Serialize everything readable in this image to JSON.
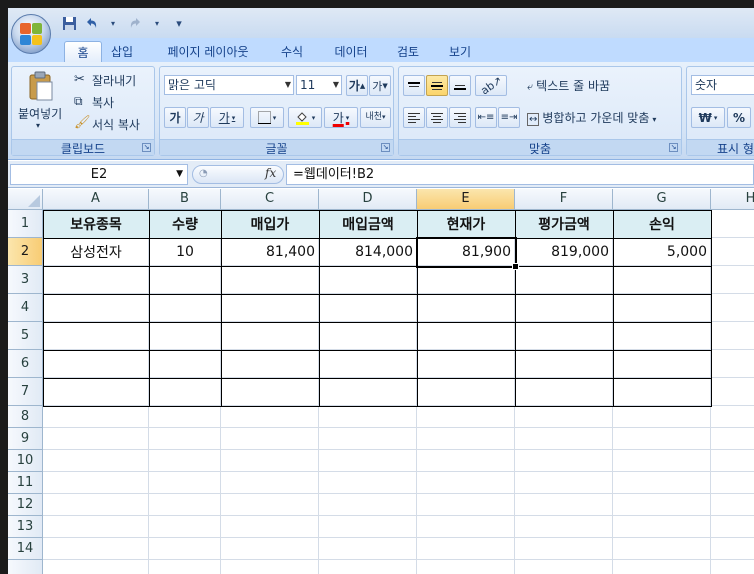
{
  "quick_access": {
    "menu_arrow": "▾"
  },
  "tabs": [
    "홈",
    "삽입",
    "페이지 레이아웃",
    "수식",
    "데이터",
    "검토",
    "보기"
  ],
  "active_tab": "홈",
  "ribbon": {
    "clipboard": {
      "paste": "붙여넣기",
      "cut": "잘라내기",
      "copy": "복사",
      "format_painter": "서식 복사",
      "label": "클립보드"
    },
    "font": {
      "name": "맑은 고딕",
      "size": "11",
      "grow": "가",
      "shrink": "가",
      "bold": "가",
      "italic": "가",
      "underline": "가",
      "font_color_glyph": "가",
      "phonetic": "내천",
      "label": "글꼴"
    },
    "alignment": {
      "wrap_text": "텍스트 줄 바꿈",
      "merge_center": "병합하고 가운데 맞춤",
      "label": "맞춤"
    },
    "number": {
      "format": "숫자",
      "currency": "₩",
      "percent": "%",
      "label": "표시 형식"
    }
  },
  "formula_bar": {
    "name_box": "E2",
    "fx": "fx",
    "formula": "=웹데이터!B2"
  },
  "columns": [
    "A",
    "B",
    "C",
    "D",
    "E",
    "F",
    "G",
    "H"
  ],
  "selected_column": "E",
  "rows": [
    "1",
    "2",
    "3",
    "4",
    "5",
    "6",
    "7",
    "8",
    "9",
    "10",
    "11",
    "12",
    "13",
    "14"
  ],
  "selected_row": "2",
  "table": {
    "headers": [
      "보유종목",
      "수량",
      "매입가",
      "매입금액",
      "현재가",
      "평가금액",
      "손익"
    ],
    "rows": [
      [
        "삼성전자",
        "10",
        "81,400",
        "814,000",
        "81,900",
        "819,000",
        "5,000"
      ]
    ]
  },
  "colors": {
    "header_fill": "#daeef3",
    "selection_highlight": "#f8cc74",
    "ribbon_blue": "#bfdbff"
  }
}
